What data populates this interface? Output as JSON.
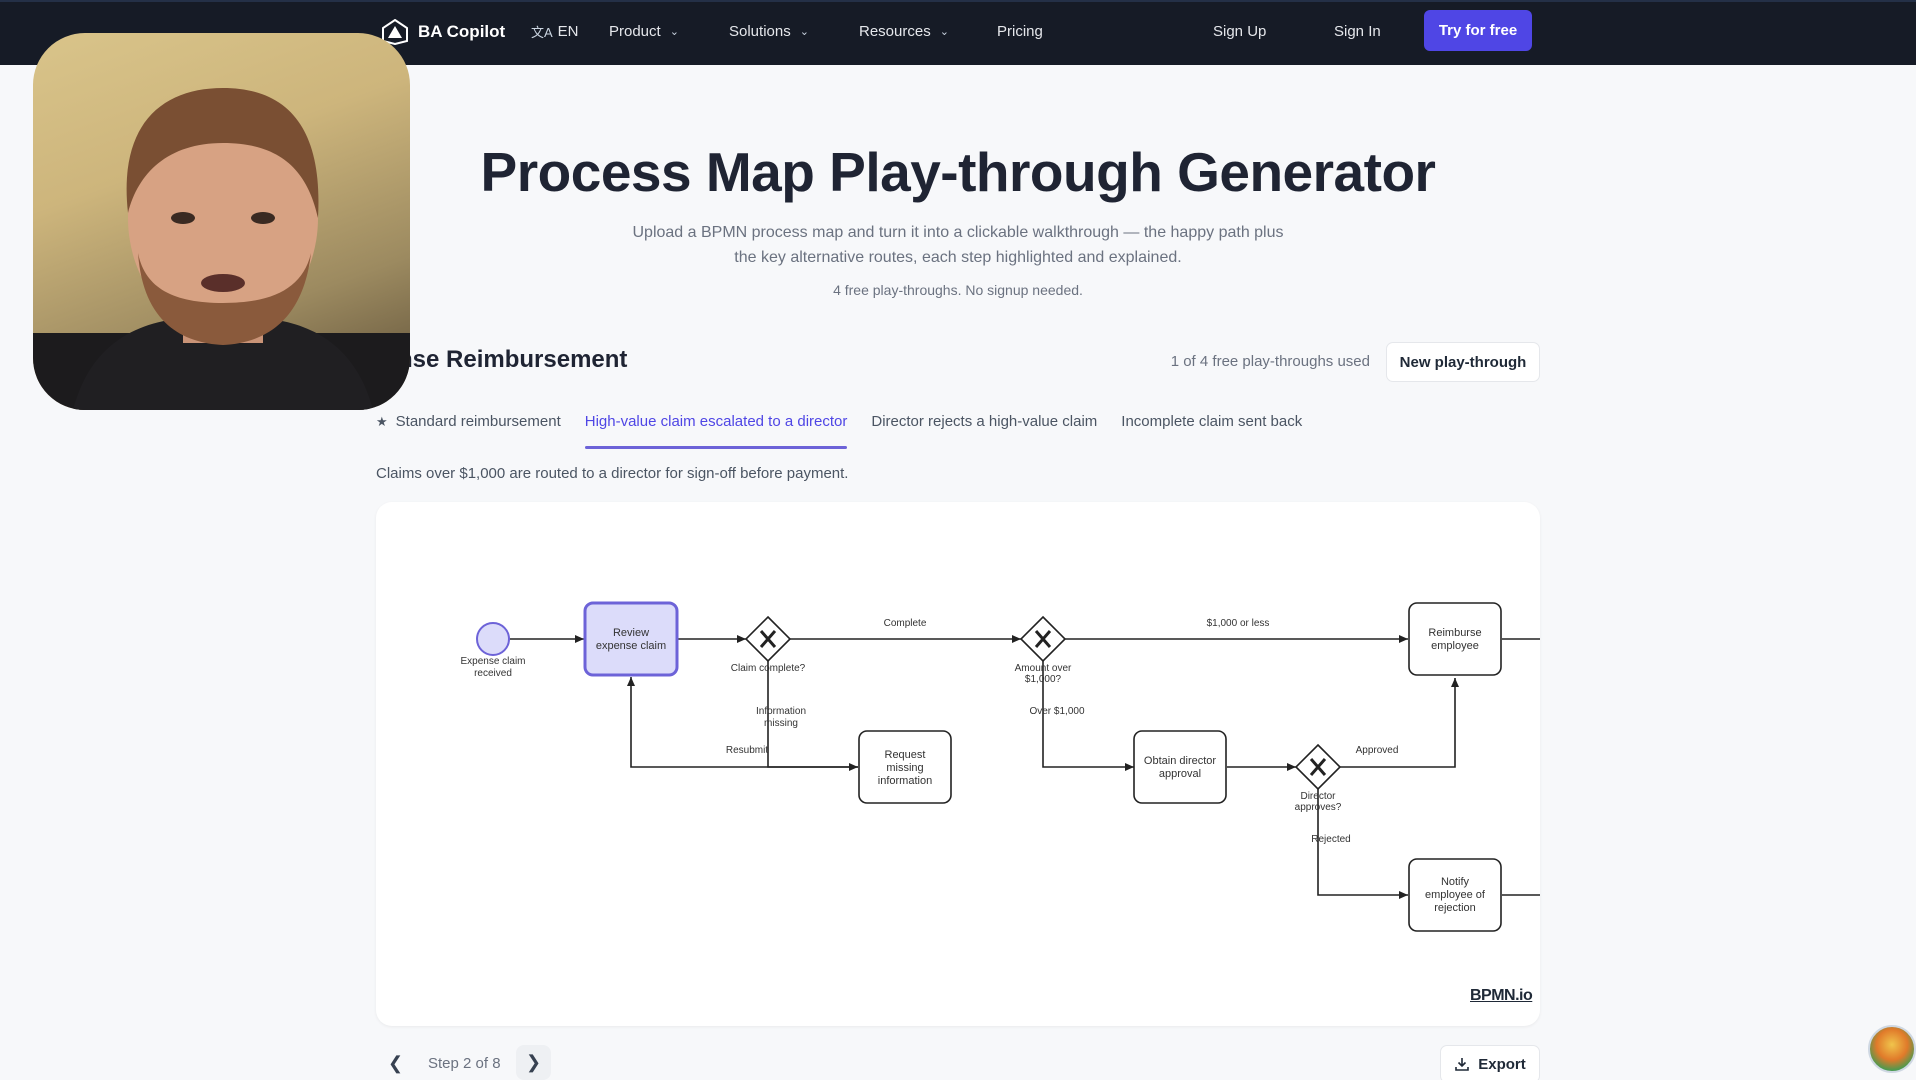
{
  "nav": {
    "brand": "BA Copilot",
    "lang": "EN",
    "items": [
      {
        "label": "Product"
      },
      {
        "label": "Solutions"
      },
      {
        "label": "Resources"
      },
      {
        "label": "Pricing"
      }
    ],
    "sign_up": "Sign Up",
    "sign_in": "Sign In",
    "try_free": "Try for free"
  },
  "hero": {
    "title": "Process Map Play-through Generator",
    "subtitle_line1": "Upload a BPMN process map and turn it into a clickable walkthrough — the happy path plus",
    "subtitle_line2": "the key alternative routes, each step highlighted and explained.",
    "free_note": "4 free play-throughs. No signup needed."
  },
  "map": {
    "title": "pense Reimbursement",
    "usage": "1 of 4 free play-throughs used",
    "new_button": "New play-through",
    "tabs": [
      {
        "label": "Standard reimbursement",
        "icon": "star-icon"
      },
      {
        "label": "High-value claim escalated to a director",
        "active": true
      },
      {
        "label": "Director rejects a high-value claim"
      },
      {
        "label": "Incomplete claim sent back"
      }
    ],
    "description": "Claims over $1,000 are routed to a director for sign-off before payment."
  },
  "diagram": {
    "start_label_1": "Expense claim",
    "start_label_2": "received",
    "task_review_1": "Review",
    "task_review_2": "expense claim",
    "gw1_label": "Claim complete?",
    "flow_complete": "Complete",
    "gw2_label_1": "Amount over",
    "gw2_label_2": "$1,000?",
    "flow_1000_or_less": "$1,000 or less",
    "task_reimburse_1": "Reimburse",
    "task_reimburse_2": "employee",
    "flow_info_missing_1": "Information",
    "flow_info_missing_2": "missing",
    "flow_resubmit": "Resubmit",
    "task_request_1": "Request",
    "task_request_2": "missing",
    "task_request_3": "information",
    "flow_over_1000": "Over $1,000",
    "task_obtain_1": "Obtain director",
    "task_obtain_2": "approval",
    "gw3_label_1": "Director",
    "gw3_label_2": "approves?",
    "flow_approved": "Approved",
    "flow_rejected": "Rejected",
    "task_notify_1": "Notify",
    "task_notify_2": "employee of",
    "task_notify_3": "rejection",
    "watermark": "BPMN.io",
    "highlight_color": "#6d63d8",
    "highlight_fill": "#dcdcfa"
  },
  "stepper": {
    "step_text": "Step 2 of 8",
    "export": "Export"
  }
}
